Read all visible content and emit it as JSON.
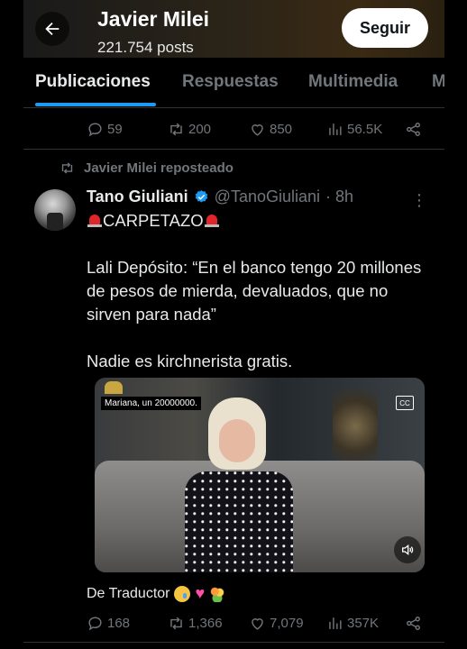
{
  "header": {
    "title": "Javier Milei",
    "subtitle": "221.754 posts",
    "follow_label": "Seguir"
  },
  "tabs": [
    {
      "label": "Publicaciones",
      "active": true
    },
    {
      "label": "Respuestas",
      "active": false
    },
    {
      "label": "Multimedia",
      "active": false
    },
    {
      "label": "M",
      "active": false
    }
  ],
  "prev_post": {
    "replies": "59",
    "reposts": "200",
    "likes": "850",
    "views": "56.5K"
  },
  "post": {
    "repost_label": "Javier Milei reposteado",
    "author_name": "Tano Giuliani",
    "handle": "@TanoGiuliani",
    "time": "· 8h",
    "headline": "CARPETAZO",
    "paragraph1": "Lali Depósito: “En el banco tengo 20 millones de pesos de mierda, devaluados, que no sirven para nada”",
    "paragraph2": "Nadie es kirchnerista gratis.",
    "video_caption": "Mariana, un 20000000.",
    "credit": "De Traductor",
    "replies": "168",
    "reposts": "1,366",
    "likes": "7,079",
    "views": "357K"
  },
  "colors": {
    "accent": "#1d9bf0",
    "text": "#e7e9ea",
    "muted": "#71767b",
    "background": "#000000"
  }
}
